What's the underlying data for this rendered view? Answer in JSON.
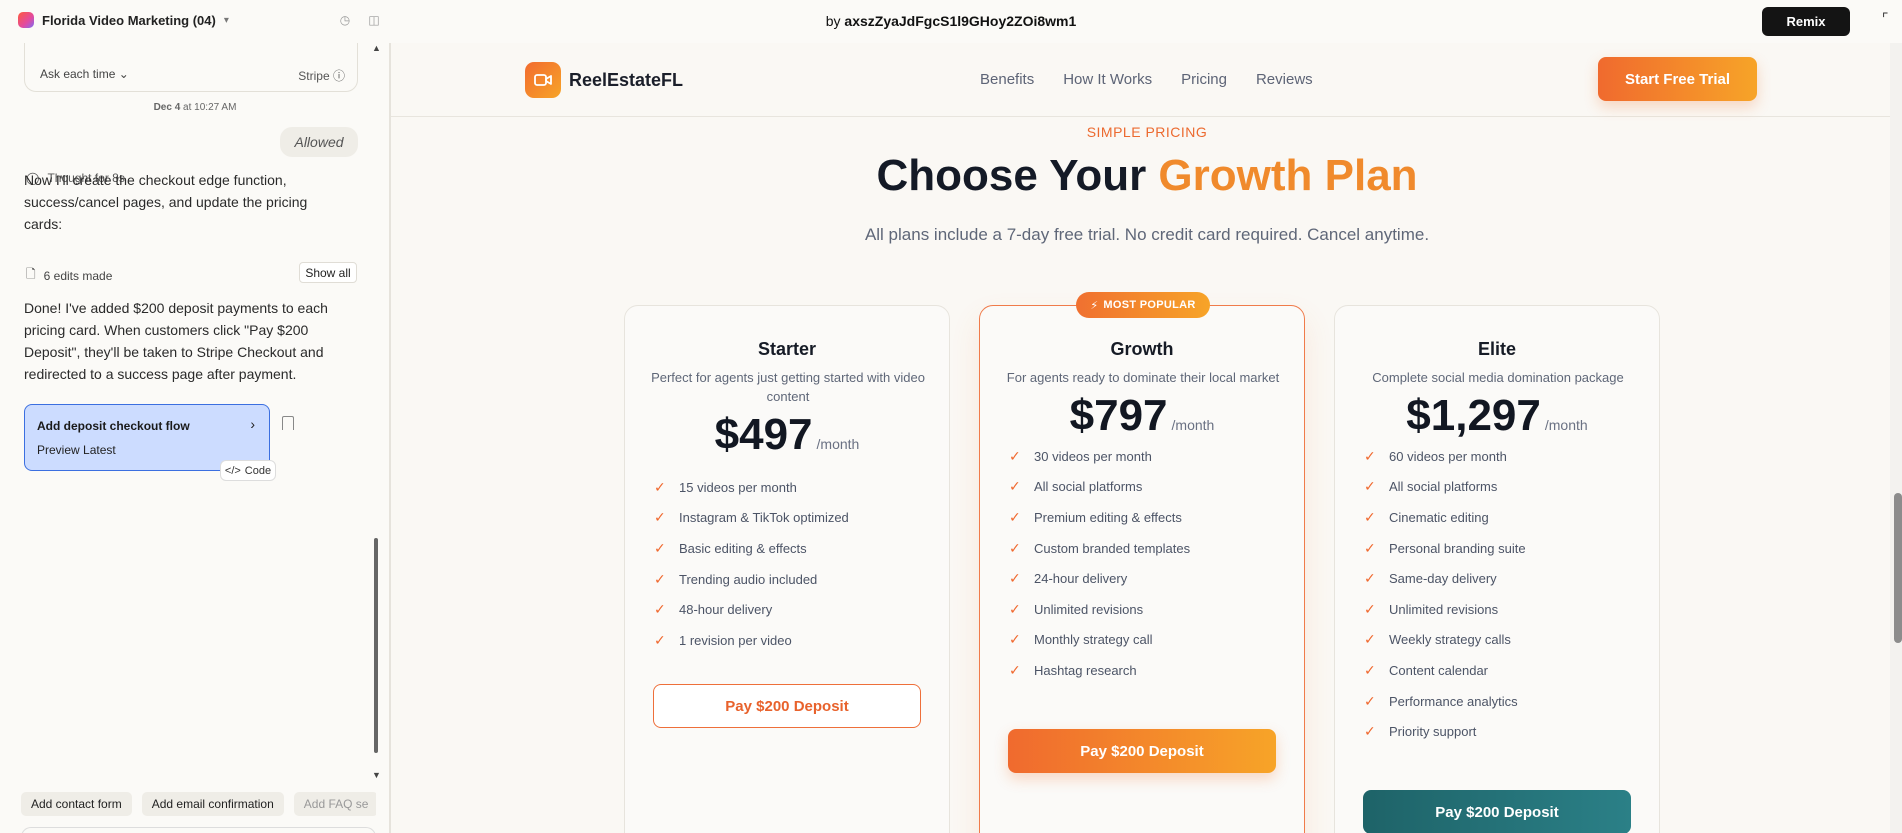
{
  "topbar": {
    "project_title": "Florida Video Marketing (04)",
    "by_label": "by",
    "author_id": "axszZyaJdFgcS1l9GHoy2ZOi8wm1",
    "remix_label": "Remix"
  },
  "sidebar": {
    "ask_label": "Ask each time",
    "stripe_label": "Stripe",
    "stamp_date": "Dec 4",
    "stamp_time": "at 10:27 AM",
    "allowed_label": "Allowed",
    "thought_label": "Thought for 8s",
    "message_1": "Now I'll create the checkout edge function, success/cancel pages, and update the pricing cards:",
    "edits_label": "6 edits made",
    "show_all_label": "Show all",
    "message_2": "Done! I've added $200 deposit payments to each pricing card. When customers click \"Pay $200 Deposit\", they'll be taken to Stripe Checkout and redirected to a success page after payment.",
    "flow_card": {
      "title": "Add deposit checkout flow",
      "subtitle": "Preview Latest"
    },
    "code_label": "Code",
    "chips": [
      "Add contact form",
      "Add email confirmation",
      "Add FAQ se"
    ]
  },
  "preview": {
    "brand": "ReelEstateFL",
    "nav_links": [
      "Benefits",
      "How It Works",
      "Pricing",
      "Reviews"
    ],
    "cta": "Start Free Trial",
    "eyebrow": "SIMPLE PRICING",
    "headline_plain": "Choose Your ",
    "headline_accent": "Growth Plan",
    "subheadline": "All plans include a 7-day free trial. No credit card required. Cancel anytime.",
    "badge": "MOST POPULAR",
    "plans": [
      {
        "name": "Starter",
        "desc": "Perfect for agents just getting started with video content",
        "price": "$497",
        "period": "/month",
        "features": [
          "15 videos per month",
          "Instagram & TikTok optimized",
          "Basic editing & effects",
          "Trending audio included",
          "48-hour delivery",
          "1 revision per video"
        ],
        "button": "Pay $200 Deposit"
      },
      {
        "name": "Growth",
        "desc": "For agents ready to dominate their local market",
        "price": "$797",
        "period": "/month",
        "features": [
          "30 videos per month",
          "All social platforms",
          "Premium editing & effects",
          "Custom branded templates",
          "24-hour delivery",
          "Unlimited revisions",
          "Monthly strategy call",
          "Hashtag research"
        ],
        "button": "Pay $200 Deposit"
      },
      {
        "name": "Elite",
        "desc": "Complete social media domination package",
        "price": "$1,297",
        "period": "/month",
        "features": [
          "60 videos per month",
          "All social platforms",
          "Cinematic editing",
          "Personal branding suite",
          "Same-day delivery",
          "Unlimited revisions",
          "Weekly strategy calls",
          "Content calendar",
          "Performance analytics",
          "Priority support"
        ],
        "button": "Pay $200 Deposit"
      }
    ]
  },
  "colors": {
    "accent_orange": "#f06a2e",
    "accent_gold": "#f7a428",
    "teal": "#1e6368",
    "selected_card": "#ccdcff"
  }
}
